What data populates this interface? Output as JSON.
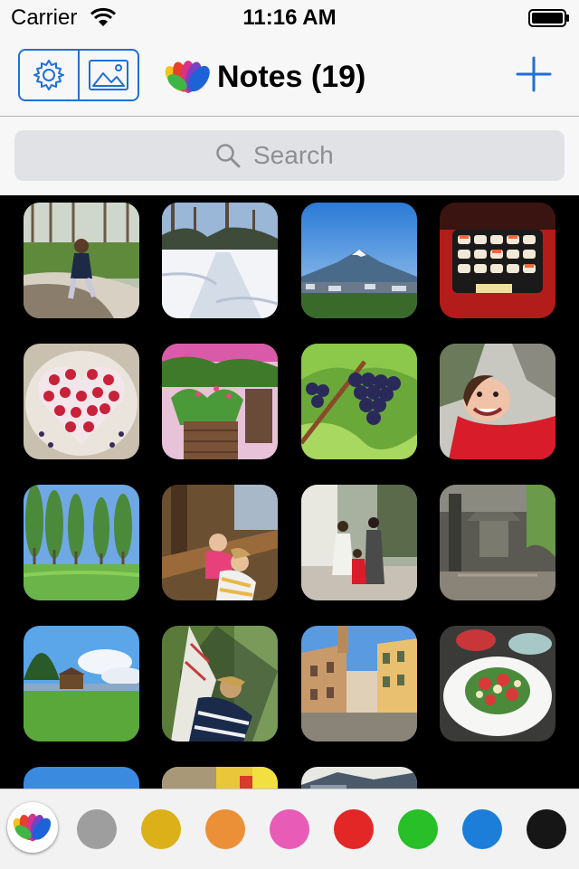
{
  "status": {
    "carrier": "Carrier",
    "time": "11:16 AM"
  },
  "nav": {
    "title": "Notes (19)",
    "settings_icon": "gear-icon",
    "gallery_icon": "image-icon",
    "add_icon": "plus-icon"
  },
  "search": {
    "placeholder": "Search",
    "icon": "magnifier-icon"
  },
  "photos": [
    "girl-in-park",
    "snowy-path",
    "mount-fuji",
    "sushi-tray",
    "berry-cake",
    "flower-balcony",
    "grapes",
    "child-smiling",
    "tree-avenue",
    "kids-on-bench",
    "family-walk",
    "temple-garden",
    "lakeside-meadow",
    "hammock-nap",
    "italian-street",
    "salad-plate",
    "sky-partial",
    "playground-partial",
    "building-partial"
  ],
  "palette": {
    "colors": [
      "#9e9e9e",
      "#dcb018",
      "#ec9038",
      "#e85cb8",
      "#e32626",
      "#28bf28",
      "#1c7ed8",
      "#161616"
    ],
    "selected": "logo"
  }
}
